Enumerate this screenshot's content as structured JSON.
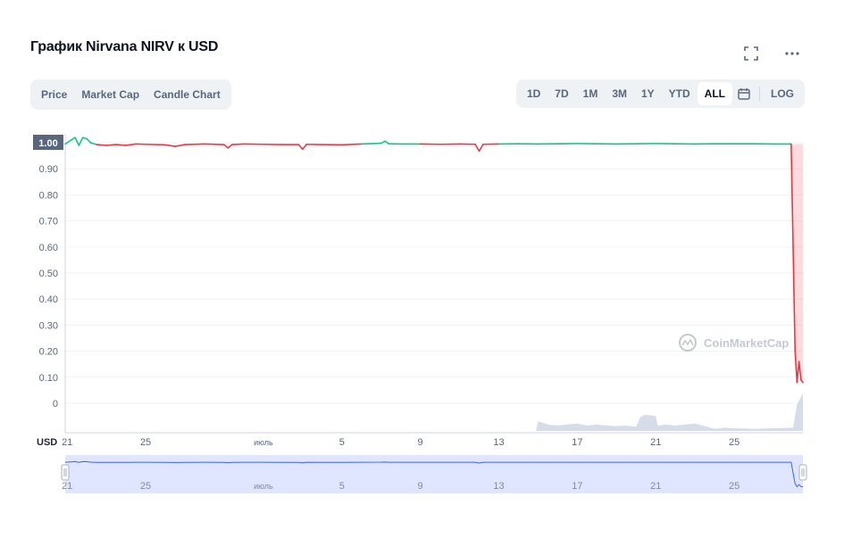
{
  "header": {
    "title": "График Nirvana NIRV к USD"
  },
  "icons": {
    "fullscreen": "fullscreen-icon",
    "more": "more-icon",
    "calendar": "calendar-icon"
  },
  "tabs": [
    {
      "label": "Price"
    },
    {
      "label": "Market Cap"
    },
    {
      "label": "Candle Chart"
    }
  ],
  "ranges": [
    {
      "label": "1D"
    },
    {
      "label": "7D"
    },
    {
      "label": "1M"
    },
    {
      "label": "3M"
    },
    {
      "label": "1Y"
    },
    {
      "label": "YTD"
    },
    {
      "label": "ALL",
      "active": true
    }
  ],
  "log_label": "LOG",
  "watermark": "CoinMarketCap",
  "colors": {
    "up": "#16c784",
    "down": "#ea3943",
    "volume": "#cfd6e4",
    "navigator": "#dbe2ff",
    "navigator_line": "#3861fb",
    "current_tag": "#58667e"
  },
  "chart_data": {
    "type": "line",
    "title": "График Nirvana NIRV к USD",
    "ylabel": "USD",
    "ylim": [
      0,
      1.0
    ],
    "yticks": [
      "1.00",
      "0.90",
      "0.80",
      "0.70",
      "0.60",
      "0.50",
      "0.40",
      "0.30",
      "0.20",
      "0.10",
      "0"
    ],
    "current_value": "1.00",
    "xticks": [
      "21",
      "25",
      "июль",
      "5",
      "9",
      "13",
      "17",
      "21",
      "25"
    ],
    "xtick_days": [
      0,
      4,
      10,
      14,
      18,
      22,
      26,
      30,
      34
    ],
    "x_range_days": [
      -0.1,
      37.5
    ],
    "grid": true,
    "series": [
      {
        "values": [
          [
            -0.1,
            0.995
          ],
          [
            0.2,
            1.01
          ],
          [
            0.4,
            1.02
          ],
          [
            0.6,
            0.99
          ],
          [
            0.8,
            1.02
          ],
          [
            1.0,
            1.015
          ],
          [
            1.2,
            1.0
          ],
          [
            1.5,
            0.993
          ],
          [
            2.0,
            0.99
          ],
          [
            2.5,
            0.993
          ],
          [
            3.0,
            0.99
          ],
          [
            3.5,
            0.995
          ],
          [
            4.0,
            0.994
          ],
          [
            5.0,
            0.992
          ],
          [
            5.5,
            0.986
          ],
          [
            6.0,
            0.993
          ],
          [
            7.0,
            0.995
          ],
          [
            8.0,
            0.993
          ],
          [
            8.2,
            0.98
          ],
          [
            8.4,
            0.993
          ],
          [
            9.0,
            0.995
          ],
          [
            10.0,
            0.994
          ],
          [
            11.0,
            0.993
          ],
          [
            11.8,
            0.993
          ],
          [
            12.0,
            0.975
          ],
          [
            12.2,
            0.994
          ],
          [
            13.0,
            0.993
          ],
          [
            14.0,
            0.992
          ],
          [
            15.0,
            0.995
          ],
          [
            16.0,
            0.998
          ],
          [
            16.2,
            1.006
          ],
          [
            16.4,
            0.996
          ],
          [
            17.0,
            0.995
          ],
          [
            18.0,
            0.995
          ],
          [
            19.0,
            0.994
          ],
          [
            20.0,
            0.995
          ],
          [
            20.8,
            0.994
          ],
          [
            21.0,
            0.968
          ],
          [
            21.2,
            0.994
          ],
          [
            22.0,
            0.995
          ],
          [
            23.0,
            0.996
          ],
          [
            24.0,
            0.995
          ],
          [
            25.0,
            0.996
          ],
          [
            26.0,
            0.997
          ],
          [
            27.0,
            0.996
          ],
          [
            28.0,
            0.995
          ],
          [
            29.0,
            0.996
          ],
          [
            30.0,
            0.997
          ],
          [
            31.0,
            0.996
          ],
          [
            32.0,
            0.995
          ],
          [
            33.0,
            0.996
          ],
          [
            34.0,
            0.996
          ],
          [
            35.0,
            0.996
          ],
          [
            36.0,
            0.995
          ],
          [
            36.9,
            0.995
          ],
          [
            37.0,
            0.6
          ],
          [
            37.1,
            0.2
          ],
          [
            37.2,
            0.08
          ],
          [
            37.3,
            0.16
          ],
          [
            37.4,
            0.09
          ],
          [
            37.5,
            0.08
          ]
        ]
      }
    ],
    "volume": [
      [
        23.9,
        0.0
      ],
      [
        24.0,
        0.18
      ],
      [
        24.5,
        0.12
      ],
      [
        25.0,
        0.1
      ],
      [
        25.5,
        0.12
      ],
      [
        26.0,
        0.14
      ],
      [
        26.5,
        0.1
      ],
      [
        27.0,
        0.12
      ],
      [
        27.5,
        0.1
      ],
      [
        28.0,
        0.09
      ],
      [
        28.5,
        0.1
      ],
      [
        29.0,
        0.08
      ],
      [
        29.2,
        0.25
      ],
      [
        29.4,
        0.3
      ],
      [
        29.8,
        0.29
      ],
      [
        30.0,
        0.28
      ],
      [
        30.1,
        0.1
      ],
      [
        30.5,
        0.12
      ],
      [
        31.0,
        0.1
      ],
      [
        31.5,
        0.12
      ],
      [
        32.0,
        0.14
      ],
      [
        32.5,
        0.09
      ],
      [
        33.0,
        0.04
      ],
      [
        33.5,
        0.06
      ],
      [
        34.0,
        0.05
      ],
      [
        35.0,
        0.04
      ],
      [
        36.0,
        0.05
      ],
      [
        37.0,
        0.06
      ],
      [
        37.2,
        0.5
      ],
      [
        37.5,
        0.7
      ]
    ]
  }
}
